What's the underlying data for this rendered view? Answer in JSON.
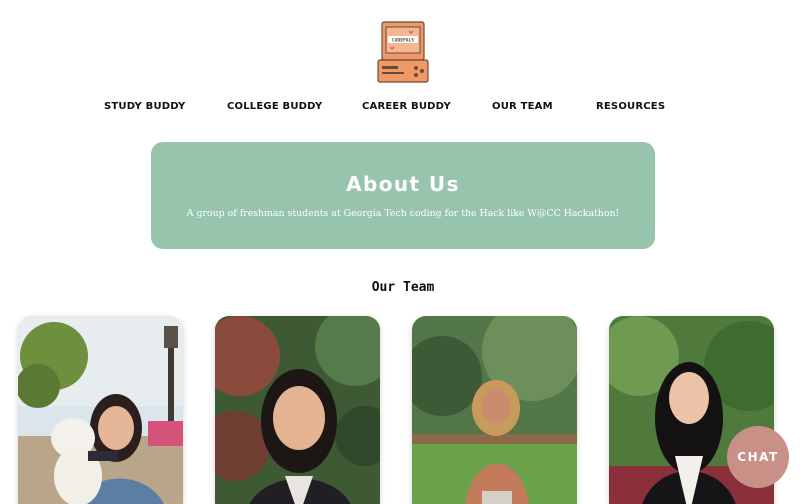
{
  "logo": {
    "screen_text": "CODEPALS",
    "icon": "retro-computer-logo"
  },
  "nav": {
    "items": [
      {
        "label": "STUDY BUDDY"
      },
      {
        "label": "COLLEGE BUDDY"
      },
      {
        "label": "CAREER BUDDY"
      },
      {
        "label": "OUR TEAM"
      },
      {
        "label": "RESOURCES"
      }
    ]
  },
  "about": {
    "title": "About Us",
    "description": "A group of freshman students at Georgia Tech coding for the Hack like W@CC Hackathon!"
  },
  "team": {
    "heading": "Our Team",
    "members": [
      {
        "photo": "team-member-photo-1"
      },
      {
        "photo": "team-member-photo-2"
      },
      {
        "photo": "team-member-photo-3"
      },
      {
        "photo": "team-member-photo-4"
      }
    ]
  },
  "chat": {
    "label": "CHAT"
  },
  "colors": {
    "about_bg": "#96c4ad",
    "chat_bg": "#c99087",
    "logo_orange": "#ef9a66"
  }
}
